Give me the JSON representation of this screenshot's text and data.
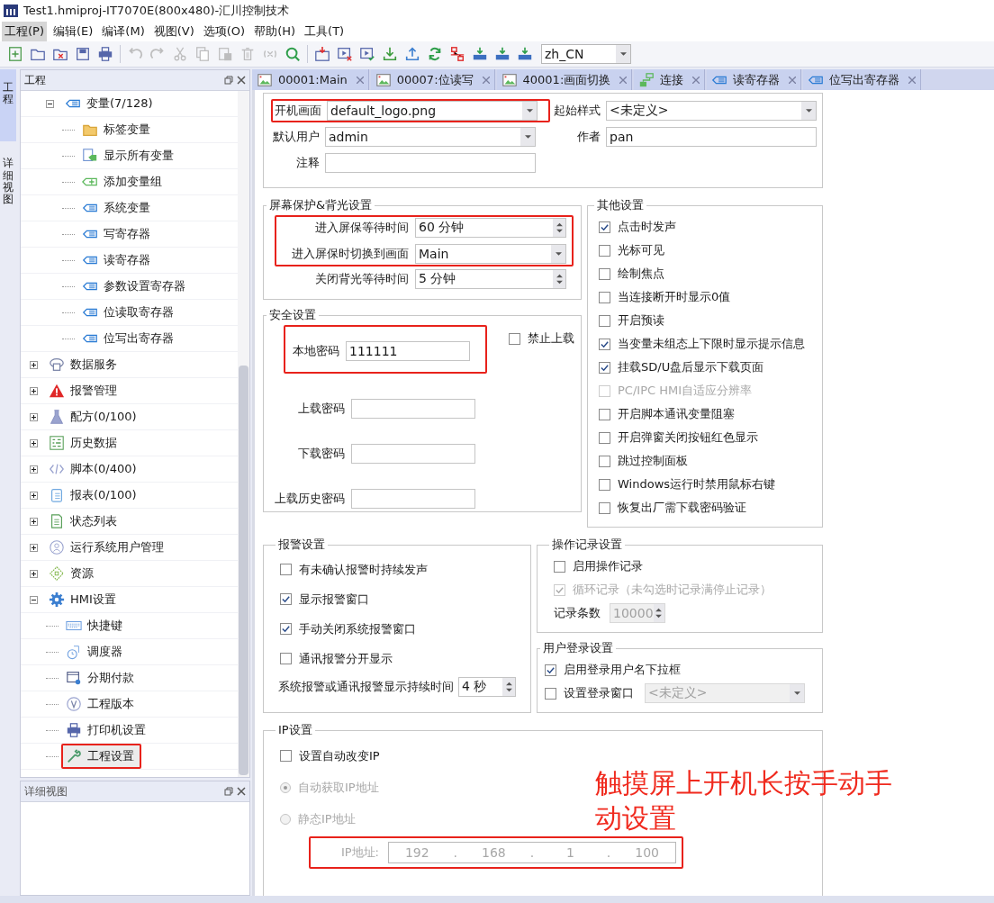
{
  "window": {
    "title": "Test1.hmiproj-IT7070E(800x480)-汇川控制技术"
  },
  "menu": [
    {
      "label": "工程(P)",
      "selected": true
    },
    {
      "label": "编辑(E)",
      "selected": false
    },
    {
      "label": "编译(M)",
      "selected": false
    },
    {
      "label": "视图(V)",
      "selected": false
    },
    {
      "label": "选项(O)",
      "selected": false
    },
    {
      "label": "帮助(H)",
      "selected": false
    },
    {
      "label": "工具(T)",
      "selected": false
    }
  ],
  "toolbar": {
    "groups": [
      [
        {
          "kind": "new",
          "disabled": false
        },
        {
          "kind": "open",
          "disabled": false
        },
        {
          "kind": "close",
          "disabled": false
        },
        {
          "kind": "save",
          "disabled": false
        },
        {
          "kind": "print",
          "disabled": false
        }
      ],
      [
        {
          "kind": "undo",
          "disabled": true
        },
        {
          "kind": "redo",
          "disabled": true
        },
        {
          "kind": "cut",
          "disabled": true
        },
        {
          "kind": "copy",
          "disabled": true
        },
        {
          "kind": "paste",
          "disabled": true
        },
        {
          "kind": "delete",
          "disabled": true
        },
        {
          "kind": "variable",
          "disabled": true
        },
        {
          "kind": "search",
          "disabled": false
        }
      ],
      [
        {
          "kind": "compile",
          "disabled": false
        },
        {
          "kind": "offline",
          "disabled": false
        },
        {
          "kind": "online",
          "disabled": false
        },
        {
          "kind": "download",
          "disabled": false
        },
        {
          "kind": "upload",
          "disabled": false
        },
        {
          "kind": "refresh",
          "disabled": false
        },
        {
          "kind": "network",
          "disabled": false
        },
        {
          "kind": "device",
          "disabled": false
        },
        {
          "kind": "device",
          "disabled": false
        },
        {
          "kind": "device",
          "disabled": false
        }
      ]
    ],
    "language": "zh_CN"
  },
  "side_tabs": [
    {
      "label": "工程",
      "selected": true
    },
    {
      "label": "详细视图",
      "selected": false
    }
  ],
  "project_panel": {
    "title": "工程",
    "tree": {
      "partial_branch": [
        {
          "label": "变量(7/128)",
          "kind": "var",
          "expanded": true,
          "selected": false,
          "highlighted": false,
          "children": [
            {
              "label": "标签变量",
              "kind": "folder",
              "selected": false,
              "highlighted": false
            },
            {
              "label": "显示所有变量",
              "kind": "allvars",
              "selected": false,
              "highlighted": false
            },
            {
              "label": "添加变量组",
              "kind": "add",
              "selected": false,
              "highlighted": false
            },
            {
              "label": "系统变量",
              "kind": "var",
              "selected": false,
              "highlighted": false
            },
            {
              "label": "写寄存器",
              "kind": "var",
              "selected": false,
              "highlighted": false
            },
            {
              "label": "读寄存器",
              "kind": "var",
              "selected": false,
              "highlighted": false
            },
            {
              "label": "参数设置寄存器",
              "kind": "var",
              "selected": false,
              "highlighted": false
            },
            {
              "label": "位读取寄存器",
              "kind": "var",
              "selected": false,
              "highlighted": false
            },
            {
              "label": "位写出寄存器",
              "kind": "var",
              "selected": false,
              "highlighted": false
            }
          ]
        }
      ],
      "items": [
        {
          "label": "数据服务",
          "kind": "data",
          "expanded": false,
          "selected": false,
          "highlighted": false
        },
        {
          "label": "报警管理",
          "kind": "alarm",
          "expanded": false,
          "selected": false,
          "highlighted": false
        },
        {
          "label": "配方(0/100)",
          "kind": "recipe",
          "expanded": false,
          "selected": false,
          "highlighted": false
        },
        {
          "label": "历史数据",
          "kind": "history",
          "expanded": false,
          "selected": false,
          "highlighted": false
        },
        {
          "label": "脚本(0/400)",
          "kind": "script",
          "expanded": false,
          "selected": false,
          "highlighted": false
        },
        {
          "label": "报表(0/100)",
          "kind": "report",
          "expanded": false,
          "selected": false,
          "highlighted": false
        },
        {
          "label": "状态列表",
          "kind": "status",
          "expanded": false,
          "selected": false,
          "highlighted": false
        },
        {
          "label": "运行系统用户管理",
          "kind": "user",
          "expanded": false,
          "selected": false,
          "highlighted": false
        },
        {
          "label": "资源",
          "kind": "resource",
          "expanded": false,
          "selected": false,
          "highlighted": false
        },
        {
          "label": "HMI设置",
          "kind": "gear",
          "expanded": true,
          "selected": false,
          "highlighted": false,
          "children": [
            {
              "label": "快捷键",
              "kind": "keyboard",
              "selected": false,
              "highlighted": false
            },
            {
              "label": "调度器",
              "kind": "timer",
              "selected": false,
              "highlighted": false
            },
            {
              "label": "分期付款",
              "kind": "calendar",
              "selected": false,
              "highlighted": false
            },
            {
              "label": "工程版本",
              "kind": "version",
              "selected": false,
              "highlighted": false
            },
            {
              "label": "打印机设置",
              "kind": "printer",
              "selected": false,
              "highlighted": false
            },
            {
              "label": "工程设置",
              "kind": "wrench",
              "selected": true,
              "highlighted": true
            }
          ]
        }
      ]
    }
  },
  "detail_panel": {
    "title": "详细视图"
  },
  "doc_tabs": [
    {
      "label": "00001:Main",
      "kind": "screen",
      "selected": false
    },
    {
      "label": "00007:位读写",
      "kind": "screen",
      "selected": false
    },
    {
      "label": "40001:画面切换",
      "kind": "screen",
      "selected": false
    },
    {
      "label": "连接",
      "kind": "link",
      "selected": false
    },
    {
      "label": "读寄存器",
      "kind": "var",
      "selected": false
    },
    {
      "label": "位写出寄存器",
      "kind": "var",
      "selected": false
    }
  ],
  "form": {
    "general": [
      {
        "label": "开机画面",
        "value": "default_logo.png",
        "kind": "dropdown",
        "highlighted": true
      },
      {
        "label": "起始样式",
        "value": "<未定义>",
        "kind": "dropdown",
        "highlighted": false
      },
      {
        "label": "默认用户",
        "value": "admin",
        "kind": "dropdown",
        "highlighted": false
      },
      {
        "label": "作者",
        "value": "pan",
        "kind": "text",
        "highlighted": false
      },
      {
        "label": "注释",
        "kind": "text",
        "highlighted": false
      }
    ],
    "screensaver": {
      "title": "屏幕保护&背光设置",
      "blocks": [
        {
          "highlighted": true,
          "rows": [
            {
              "label": "进入屏保等待时间",
              "value": "60 分钟",
              "kind": "spin"
            },
            {
              "label": "进入屏保时切换到画面",
              "value": "Main",
              "kind": "dropdown"
            }
          ]
        },
        {
          "highlighted": false,
          "rows": [
            {
              "label": "关闭背光等待时间",
              "value": "5 分钟",
              "kind": "spin"
            }
          ]
        }
      ]
    },
    "security": {
      "title": "安全设置",
      "local_password": {
        "label": "本地密码",
        "value": "111111",
        "highlighted": true
      },
      "no_upload": {
        "label": "禁止上载",
        "checked": false
      },
      "passwords": [
        {
          "label": "上载密码"
        },
        {
          "label": "下载密码"
        },
        {
          "label": "上载历史密码"
        }
      ]
    },
    "other": {
      "title": "其他设置",
      "items": [
        {
          "label": "点击时发声",
          "checked": true,
          "disabled": false
        },
        {
          "label": "光标可见",
          "checked": false,
          "disabled": false
        },
        {
          "label": "绘制焦点",
          "checked": false,
          "disabled": false
        },
        {
          "label": "当连接断开时显示0值",
          "checked": false,
          "disabled": false
        },
        {
          "label": "开启预读",
          "checked": false,
          "disabled": false
        },
        {
          "label": "当变量未组态上下限时显示提示信息",
          "checked": true,
          "disabled": false
        },
        {
          "label": "挂载SD/U盘后显示下载页面",
          "checked": true,
          "disabled": false
        },
        {
          "label": "PC/IPC HMI自适应分辨率",
          "checked": false,
          "disabled": true
        },
        {
          "label": "开启脚本通讯变量阻塞",
          "checked": false,
          "disabled": false
        },
        {
          "label": "开启弹窗关闭按钮红色显示",
          "checked": false,
          "disabled": false
        },
        {
          "label": "跳过控制面板",
          "checked": false,
          "disabled": false
        },
        {
          "label": "Windows运行时禁用鼠标右键",
          "checked": false,
          "disabled": false
        },
        {
          "label": "恢复出厂需下载密码验证",
          "checked": false,
          "disabled": false
        }
      ]
    },
    "alarm": {
      "title": "报警设置",
      "items": [
        {
          "label": "有未确认报警时持续发声",
          "checked": false
        },
        {
          "label": "显示报警窗口",
          "checked": true
        },
        {
          "label": "手动关闭系统报警窗口",
          "checked": true
        },
        {
          "label": "通讯报警分开显示",
          "checked": false
        }
      ],
      "duration": {
        "label": "系统报警或通讯报警显示持续时间",
        "value": "4 秒"
      }
    },
    "oplog": {
      "title": "操作记录设置",
      "items": [
        {
          "label": "启用操作记录",
          "checked": false,
          "disabled": false
        },
        {
          "label": "循环记录（未勾选时记录满停止记录）",
          "checked": true,
          "disabled": true
        }
      ],
      "count": {
        "label": "记录条数",
        "value": "10000",
        "disabled": true
      }
    },
    "login": {
      "title": "用户登录设置",
      "items": [
        {
          "label": "启用登录用户名下拉框",
          "checked": true
        },
        {
          "label": "设置登录窗口",
          "checked": false
        }
      ],
      "window_select": {
        "value": "<未定义>",
        "disabled": true
      }
    },
    "ip": {
      "title": "IP设置",
      "auto_change": {
        "label": "设置自动改变IP",
        "checked": false
      },
      "modes": [
        {
          "label": "自动获取IP地址",
          "selected": true,
          "disabled": true
        },
        {
          "label": "静态IP地址",
          "selected": false,
          "disabled": true
        }
      ],
      "address": {
        "label": "IP地址:",
        "octets": [
          "192",
          "168",
          "1",
          "100"
        ],
        "separator": ".",
        "disabled": true,
        "highlighted": true
      }
    }
  },
  "annotation": "触摸屏上开机长按手动手动设置"
}
